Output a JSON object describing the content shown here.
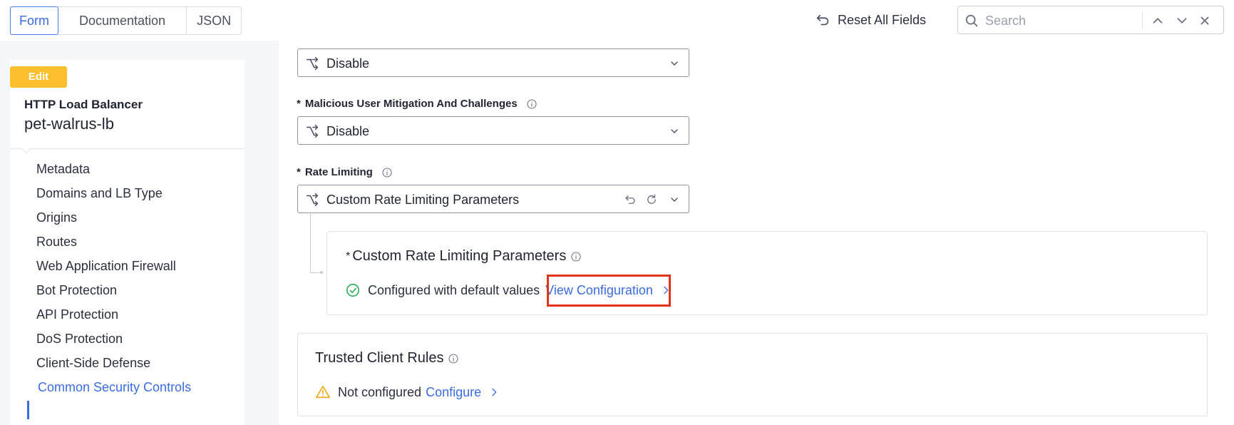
{
  "tabs": [
    {
      "label": "Form",
      "active": true
    },
    {
      "label": "Documentation",
      "active": false
    },
    {
      "label": "JSON",
      "active": false
    }
  ],
  "header": {
    "reset_label": "Reset All Fields",
    "reset_icon": "reset-icon",
    "search_placeholder": "Search"
  },
  "sidebar": {
    "badge": "Edit",
    "object_type": "HTTP Load Balancer",
    "object_name": "pet-walrus-lb",
    "items": [
      {
        "label": "Metadata"
      },
      {
        "label": "Domains and LB Type"
      },
      {
        "label": "Origins"
      },
      {
        "label": "Routes"
      },
      {
        "label": "Web Application Firewall"
      },
      {
        "label": "Bot Protection"
      },
      {
        "label": "API Protection"
      },
      {
        "label": "DoS Protection"
      },
      {
        "label": "Client-Side Defense"
      },
      {
        "label": "Common Security Controls",
        "active": true
      }
    ]
  },
  "form": {
    "top_select_value": "Disable",
    "malicious": {
      "label": "Malicious User Mitigation And Challenges",
      "required": "*",
      "value": "Disable"
    },
    "rate_limiting": {
      "label": "Rate Limiting",
      "required": "*",
      "value": "Custom Rate Limiting Parameters"
    },
    "custom_card": {
      "required": "*",
      "title": "Custom Rate Limiting Parameters",
      "status": "Configured with default values",
      "link": "View Configuration"
    },
    "trusted_card": {
      "title": "Trusted Client Rules",
      "status": "Not configured",
      "link": "Configure"
    }
  },
  "colors": {
    "accent": "#3c6be6",
    "badge": "#fbbf2d",
    "success": "#2fae5a",
    "warning": "#f0a91b",
    "highlight": "#e5331b"
  }
}
